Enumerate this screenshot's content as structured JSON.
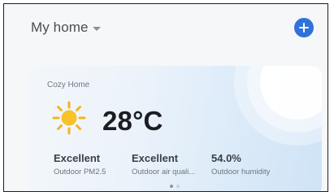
{
  "header": {
    "home_name": "My home"
  },
  "weather_card": {
    "home_label": "Cozy Home",
    "temperature": "28°C",
    "metrics": [
      {
        "value": "Excellent",
        "label": "Outdoor PM2.5"
      },
      {
        "value": "Excellent",
        "label": "Outdoor air quali..."
      },
      {
        "value": "54.0%",
        "label": "Outdoor humidity"
      }
    ],
    "page_indicator": {
      "pages": 2,
      "current": 1
    }
  },
  "colors": {
    "accent": "#2f72d9",
    "sun": "#f6b41c"
  },
  "icons": {
    "weather": "sun-icon",
    "add": "plus-icon",
    "dropdown": "chevron-down-icon"
  }
}
